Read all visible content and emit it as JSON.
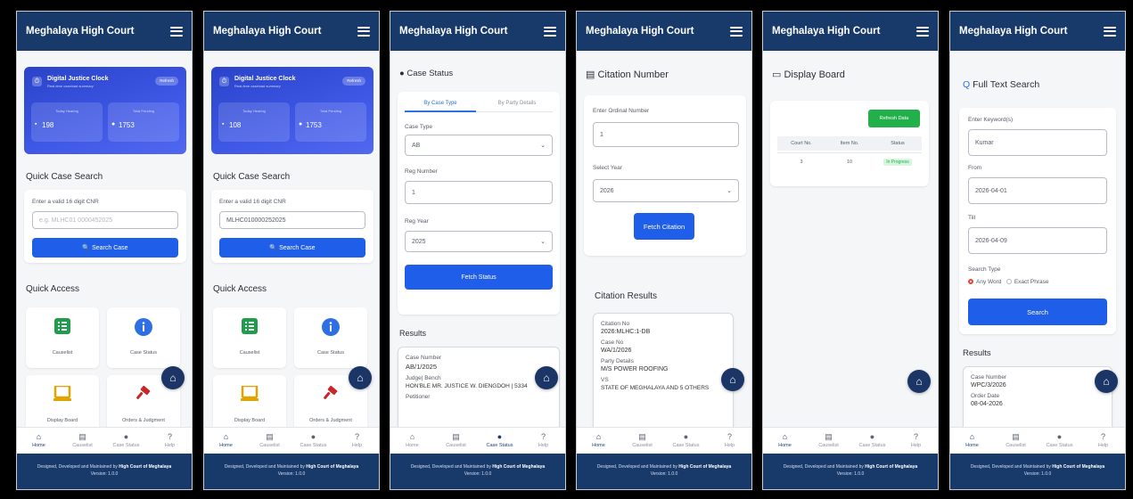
{
  "app_title": "Meghalaya High Court",
  "nav": {
    "home": "Home",
    "causelist": "Causelist",
    "case_status": "Case Status",
    "help": "Help"
  },
  "footer": {
    "line1_prefix": "Designed, Developed and Maintained by",
    "line1_org": "High Court of Meghalaya",
    "version": "Version: 1.0.0"
  },
  "icons": {
    "menu": "hamburger-icon",
    "fab": "home-icon",
    "nav_home": "home-icon",
    "nav_causelist": "list-icon",
    "nav_status": "info-icon",
    "nav_help": "help-icon"
  },
  "colors": {
    "header": "#183a6b",
    "primary_button": "#1f5ee8",
    "clock_card": "#3f58e6",
    "success": "#22b04b"
  },
  "screen1": {
    "clock": {
      "title": "Digital Justice Clock",
      "subtitle": "Real-time caseload summary",
      "refresh": "Refresh",
      "hearing_label": "Today Hearing",
      "hearing_value": "198",
      "pending_label": "Total Pending",
      "pending_value": "1753"
    },
    "quick_search": {
      "heading": "Quick Case Search",
      "label": "Enter a valid 16 digit CNR",
      "placeholder": "e.g. MLHC01 0000452025",
      "button": "Search Case"
    },
    "quick_access": {
      "heading": "Quick Access",
      "tiles": [
        "Causelist",
        "Case Status",
        "Display Board",
        "Orders & Judgment"
      ]
    }
  },
  "screen2": {
    "clock": {
      "title": "Digital Justice Clock",
      "subtitle": "Real-time caseload summary",
      "refresh": "Refresh",
      "hearing_label": "Today Hearing",
      "hearing_value": "108",
      "pending_label": "Total Pending",
      "pending_value": "1753"
    },
    "quick_search": {
      "heading": "Quick Case Search",
      "label": "Enter a valid 16 digit CNR",
      "value": "MLHC010000252025",
      "button": "Search Case"
    },
    "quick_access": {
      "heading": "Quick Access",
      "tiles": [
        "Causelist",
        "Case Status",
        "Display Board",
        "Orders & Judgment"
      ]
    }
  },
  "screen3": {
    "heading": "Case Status",
    "tabs": [
      "By Case Type",
      "By Party Details"
    ],
    "case_type_label": "Case Type",
    "case_type_value": "AB",
    "reg_number_label": "Reg Number",
    "reg_number_value": "1",
    "reg_year_label": "Reg Year",
    "reg_year_value": "2025",
    "button": "Fetch Status",
    "results_heading": "Results",
    "result": {
      "case_number_label": "Case Number",
      "case_number": "AB/1/2025",
      "judge_label": "Judge| Bench",
      "judge": "HON'BLE MR. JUSTICE W. DIENGDOH | 5334",
      "petitioner_label": "Petitioner"
    }
  },
  "screen4": {
    "heading": "Citation Number",
    "ordinal_label": "Enter Ordinal Number",
    "ordinal_value": "1",
    "year_label": "Select Year",
    "year_value": "2026",
    "button": "Fetch Citation",
    "results_heading": "Citation Results",
    "result": {
      "citation_label": "Citation No",
      "citation": "2026:MLHC:1-DB",
      "case_label": "Case No",
      "case": "WA/1/2026",
      "party_label": "Party Details",
      "party": "M/S POWER ROOFING",
      "vs": "VS",
      "respondent": "STATE OF MEGHALAYA AND 5 OTHERS"
    }
  },
  "screen5": {
    "heading": "Display Board",
    "refresh": "Refresh Data",
    "columns": [
      "Court No.",
      "Item No.",
      "Status"
    ],
    "rows": [
      {
        "court": "3",
        "item": "10",
        "status": "In Progress"
      }
    ]
  },
  "screen6": {
    "heading": "Full Text Search",
    "keyword_label": "Enter Keyword(s)",
    "keyword_value": "Kumar",
    "from_label": "From",
    "from_value": "2026-04-01",
    "till_label": "Till",
    "till_value": "2026-04-09",
    "search_type_label": "Search Type",
    "opt_any": "Any Word",
    "opt_exact": "Exact Phrase",
    "button": "Search",
    "results_heading": "Results",
    "result": {
      "case_label": "Case Number",
      "case": "WPC/3/2026",
      "order_label": "Order Date",
      "order": "08-04-2026"
    }
  }
}
